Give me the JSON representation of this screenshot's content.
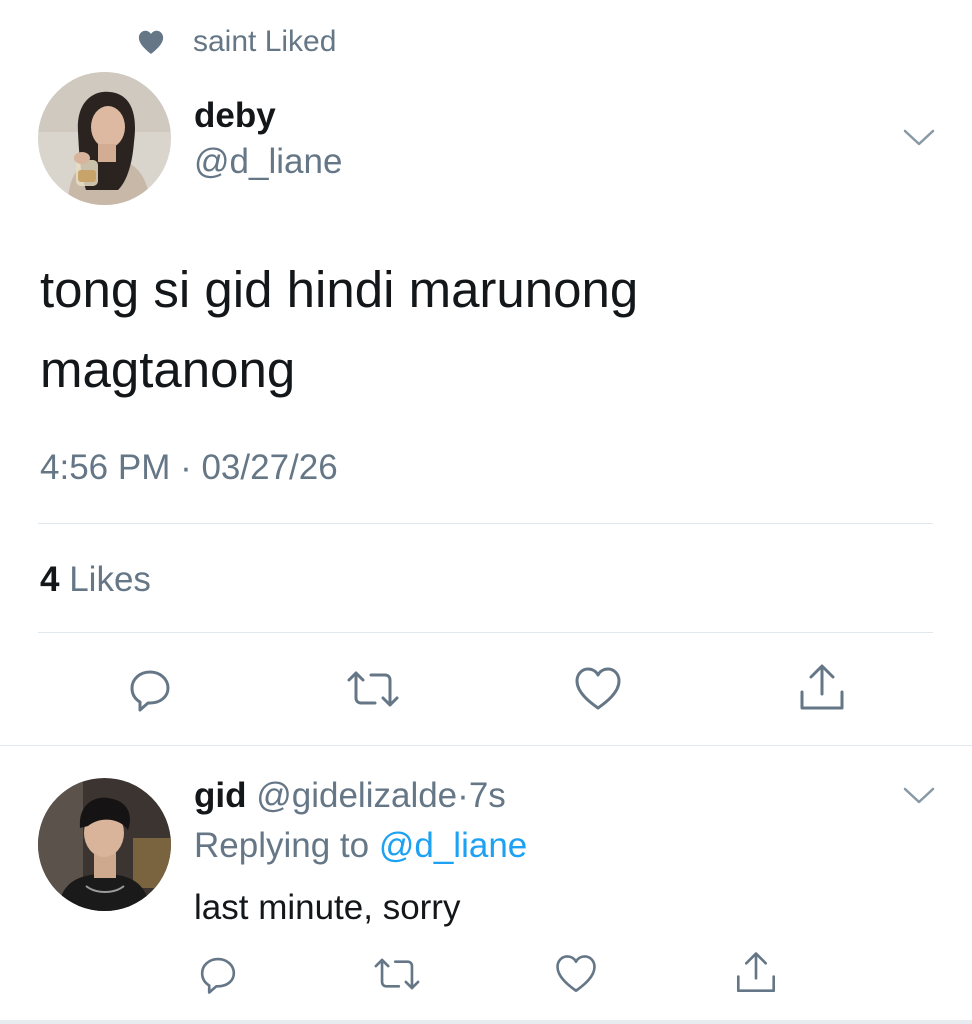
{
  "social_context": {
    "icon": "heart-icon",
    "text": "saint Liked"
  },
  "main_tweet": {
    "display_name": "deby",
    "handle": "@d_liane",
    "text_line1": "tong si gid hindi marunong",
    "text_line2": "magtanong",
    "timestamp": "4:56 PM · 03/27/26",
    "likes_count": "4",
    "likes_label": "Likes",
    "avatar": "profile-photo-deby",
    "menu_icon": "chevron-down-icon",
    "actions": [
      "reply-icon",
      "retweet-icon",
      "like-icon",
      "share-icon"
    ]
  },
  "reply_tweet": {
    "display_name": "gid",
    "handle": "@gidelizalde",
    "separator": "·",
    "time": "7s",
    "replying_prefix": "Replying to",
    "replying_to": "@d_liane",
    "text": "last minute, sorry",
    "avatar": "profile-photo-gid",
    "menu_icon": "chevron-down-icon",
    "actions": [
      "reply-icon",
      "retweet-icon",
      "like-icon",
      "share-icon"
    ]
  },
  "colors": {
    "text_primary": "#14171a",
    "text_secondary": "#657786",
    "link": "#1da1f2",
    "divider": "#e1e8ed"
  }
}
